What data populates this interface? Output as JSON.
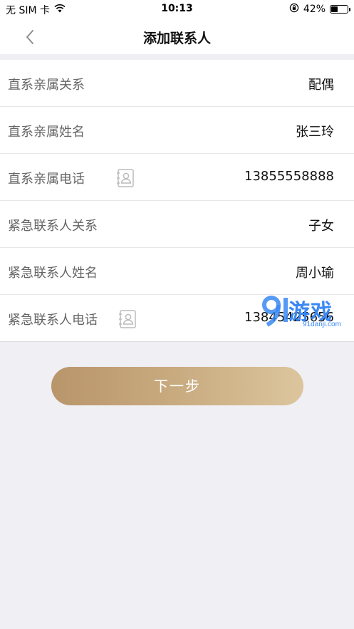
{
  "status_bar": {
    "carrier": "无 SIM 卡",
    "time": "10:13",
    "battery_percent_text": "42%",
    "battery_level": 0.42
  },
  "nav": {
    "title": "添加联系人"
  },
  "form": {
    "rows": [
      {
        "label": "直系亲属关系",
        "value": "配偶"
      },
      {
        "label": "直系亲属姓名",
        "value": "张三玲"
      },
      {
        "label": "直系亲属电话",
        "value": "13855558888"
      },
      {
        "label": "紧急联系人关系",
        "value": "子女"
      },
      {
        "label": "紧急联系人姓名",
        "value": "周小瑜"
      },
      {
        "label": "紧急联系人电话",
        "value": "13845425656"
      }
    ]
  },
  "watermark": {
    "text": "游戏",
    "url": "91danji.com"
  },
  "actions": {
    "next_label": "下一步"
  },
  "colors": {
    "accent_start": "#b9956a",
    "accent_end": "#dcc59d",
    "watermark": "#3a88f3"
  }
}
